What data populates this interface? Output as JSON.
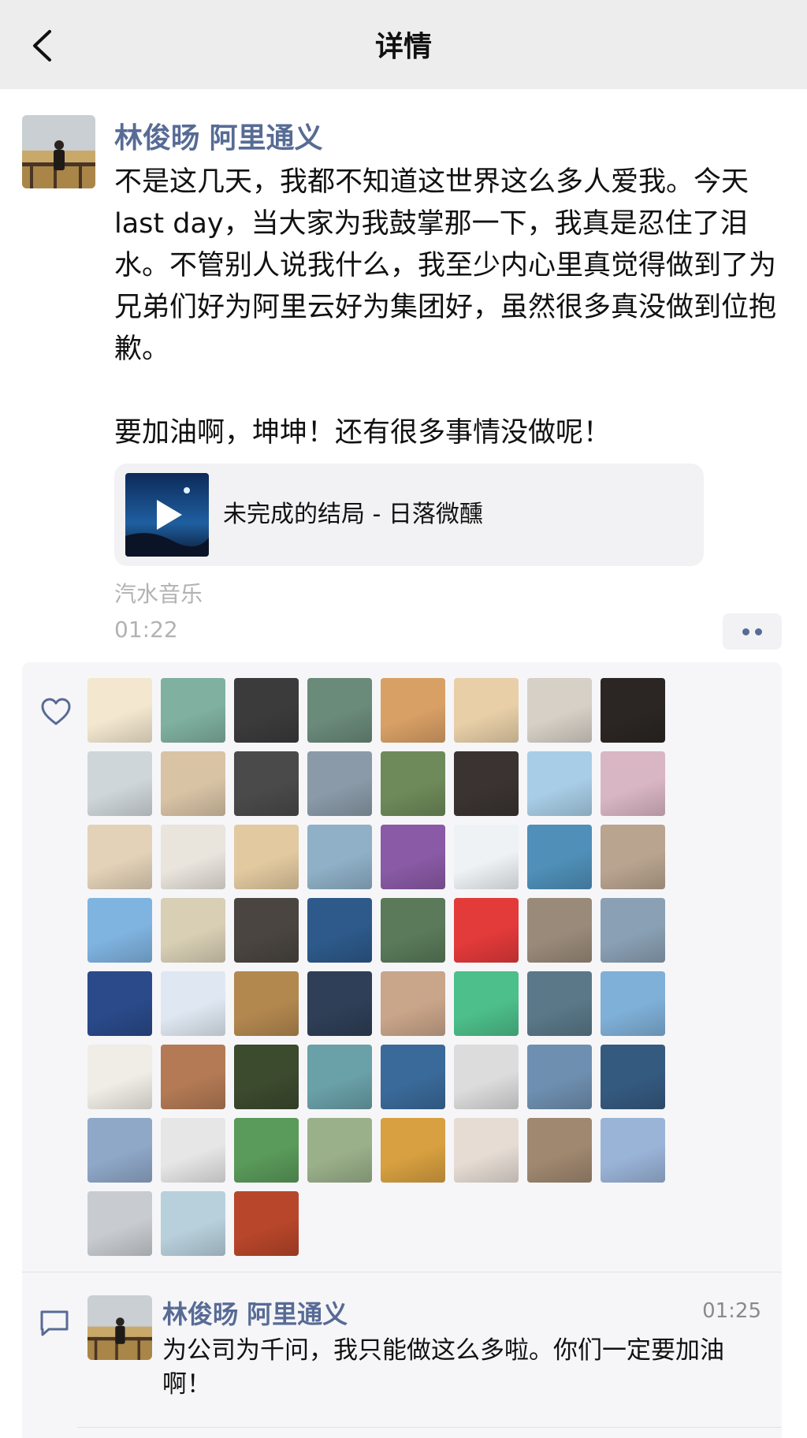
{
  "nav": {
    "title": "详情",
    "back_icon": "chevron-left-icon"
  },
  "post": {
    "author": "林俊旸 阿里通义",
    "text": "不是这几天，我都不知道这世界这么多人爱我。今天 last day，当大家为我鼓掌那一下，我真是忍住了泪水。不管别人说我什么，我至少内心里真觉得做到了为兄弟们好为阿里云好为集团好，虽然很多真没做到位抱歉。\n\n要加油啊，坤坤！还有很多事情没做呢！",
    "music": {
      "title": "未完成的结局 - 日落微醺",
      "source": "汽水音乐",
      "play_icon": "play-icon"
    },
    "time": "01:22",
    "more_icon": "more-dots-icon"
  },
  "likes": {
    "icon": "heart-icon",
    "avatars": [
      "#f3e7cf",
      "#7fb0a0",
      "#3b3b3b",
      "#6a8a7a",
      "#d9a066",
      "#e8cfa8",
      "#d6d0c6",
      "#2b2623",
      "#cfd6da",
      "#d8c3a5",
      "#4a4a4a",
      "#8a9aa8",
      "#6e8a5a",
      "#3a3331",
      "#a8cde6",
      "#d9b6c4",
      "#e3d2b8",
      "#e9e4dc",
      "#e2c9a0",
      "#8fb0c7",
      "#8a5aa6",
      "#eef2f5",
      "#4f8fb8",
      "#b9a48f",
      "#7fb3e0",
      "#d8cfb4",
      "#4a4540",
      "#2d5a8a",
      "#5a7a5a",
      "#e33a3a",
      "#9a8a7a",
      "#8aa0b4",
      "#2a4a8a",
      "#dfe8f2",
      "#b3884f",
      "#2e3f57",
      "#c9a58a",
      "#4dbf8a",
      "#5a7888",
      "#7fb0d8",
      "#f0ede6",
      "#b37a55",
      "#3c4a2e",
      "#6aa0a8",
      "#3a6a9a",
      "#dcdcdc",
      "#6f8fb0",
      "#355a80",
      "#8fa8c8",
      "#e6e6e6",
      "#5a9a5a",
      "#9ab08a",
      "#d8a040",
      "#e6dcd4",
      "#a08870",
      "#9ab4d8",
      "#c8ccd0",
      "#b8d0dc",
      "#b8462a"
    ]
  },
  "comment": {
    "icon": "comment-icon",
    "author": "林俊旸 阿里通义",
    "time": "01:25",
    "text": "为公司为千问，我只能做这么多啦。你们一定要加油啊！"
  }
}
